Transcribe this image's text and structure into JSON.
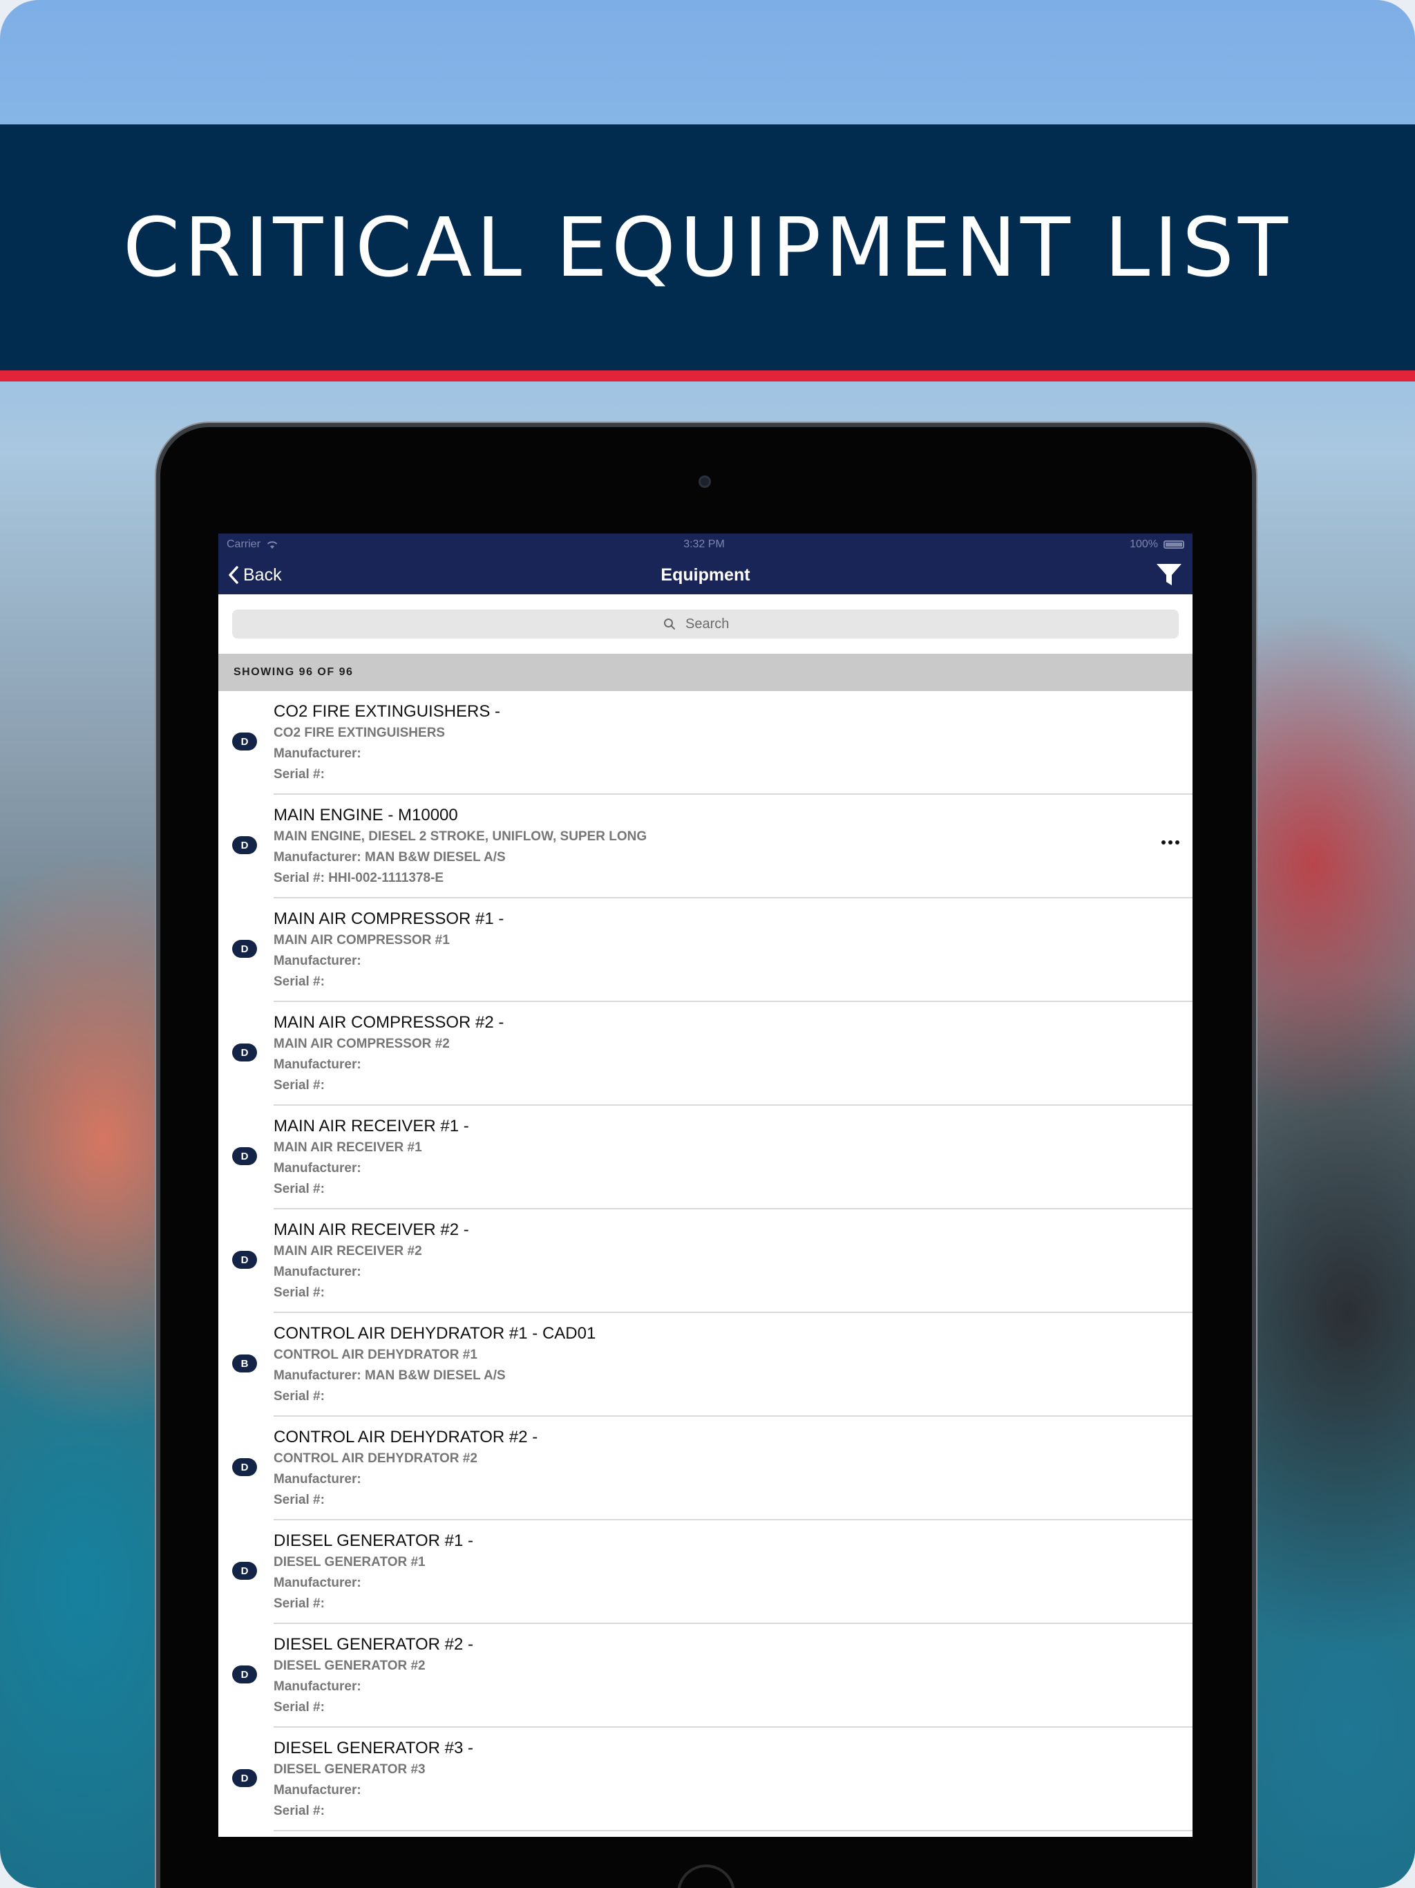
{
  "banner": {
    "title": "CRITICAL EQUIPMENT LIST"
  },
  "status_bar": {
    "carrier": "Carrier",
    "time": "3:32 PM",
    "battery": "100%"
  },
  "nav": {
    "back_label": "Back",
    "title": "Equipment",
    "filter_icon": "filter-icon"
  },
  "search": {
    "placeholder": "Search"
  },
  "list_header": {
    "showing": "SHOWING 96 OF 96"
  },
  "items": [
    {
      "badge": "D",
      "title": "CO2 FIRE EXTINGUISHERS -",
      "description": "CO2 FIRE EXTINGUISHERS",
      "manufacturer": "Manufacturer:",
      "serial": "Serial #:"
    },
    {
      "badge": "D",
      "title": "MAIN ENGINE - M10000",
      "description": "MAIN ENGINE, DIESEL 2 STROKE, UNIFLOW, SUPER LONG",
      "manufacturer": "Manufacturer: MAN B&W DIESEL A/S",
      "serial": "Serial #: HHI-002-1111378-E",
      "more": "…"
    },
    {
      "badge": "D",
      "title": "MAIN AIR COMPRESSOR #1 -",
      "description": "MAIN AIR COMPRESSOR #1",
      "manufacturer": "Manufacturer:",
      "serial": "Serial #:"
    },
    {
      "badge": "D",
      "title": "MAIN AIR COMPRESSOR #2 -",
      "description": "MAIN AIR COMPRESSOR #2",
      "manufacturer": "Manufacturer:",
      "serial": "Serial #:"
    },
    {
      "badge": "D",
      "title": "MAIN AIR RECEIVER #1 -",
      "description": "MAIN AIR RECEIVER #1",
      "manufacturer": "Manufacturer:",
      "serial": "Serial #:"
    },
    {
      "badge": "D",
      "title": "MAIN AIR RECEIVER #2 -",
      "description": "MAIN AIR RECEIVER #2",
      "manufacturer": "Manufacturer:",
      "serial": "Serial #:"
    },
    {
      "badge": "B",
      "title": "CONTROL AIR DEHYDRATOR #1 - CAD01",
      "description": "CONTROL AIR DEHYDRATOR #1",
      "manufacturer": "Manufacturer: MAN B&W DIESEL A/S",
      "serial": "Serial #:"
    },
    {
      "badge": "D",
      "title": "CONTROL AIR DEHYDRATOR #2 -",
      "description": "CONTROL AIR DEHYDRATOR #2",
      "manufacturer": "Manufacturer:",
      "serial": "Serial #:"
    },
    {
      "badge": "D",
      "title": "DIESEL GENERATOR #1 -",
      "description": "DIESEL GENERATOR #1",
      "manufacturer": "Manufacturer:",
      "serial": "Serial #:"
    },
    {
      "badge": "D",
      "title": "DIESEL GENERATOR #2 -",
      "description": "DIESEL GENERATOR #2",
      "manufacturer": "Manufacturer:",
      "serial": "Serial #:"
    },
    {
      "badge": "D",
      "title": "DIESEL GENERATOR #3 -",
      "description": "DIESEL GENERATOR #3",
      "manufacturer": "Manufacturer:",
      "serial": "Serial #:"
    }
  ],
  "colors": {
    "banner": "#022c4f",
    "stripe": "#e2243a",
    "nav": "#1a2557",
    "badge": "#142447"
  }
}
